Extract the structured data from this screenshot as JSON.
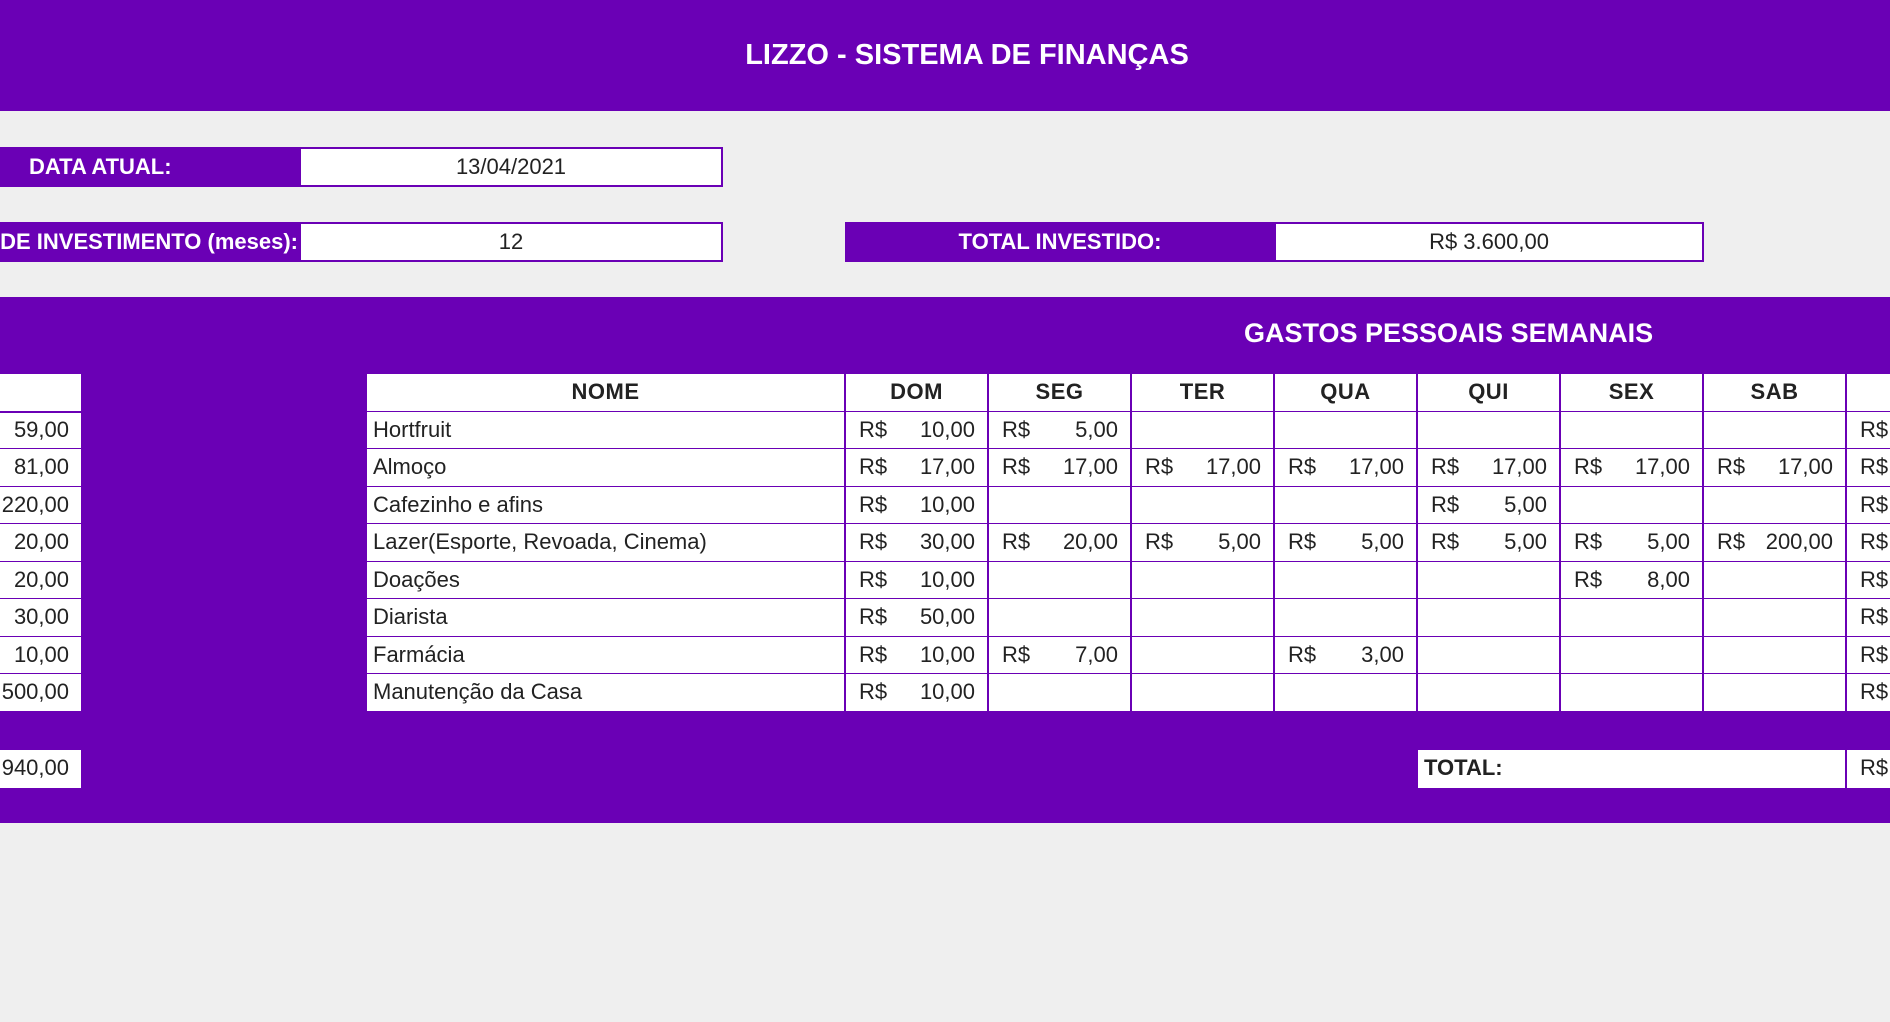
{
  "app": {
    "title": "LIZZO - SISTEMA DE FINANÇAS"
  },
  "info": {
    "date_label": "DATA ATUAL:",
    "date_value": "13/04/2021",
    "period_label": "DE INVESTIMENTO (meses):",
    "period_value": "12",
    "total_invested_label": "TOTAL INVESTIDO:",
    "total_invested_value": "R$ 3.600,00"
  },
  "section": {
    "title": "GASTOS PESSOAIS SEMANAIS"
  },
  "left_column": {
    "values": [
      "59,00",
      "81,00",
      "220,00",
      "20,00",
      "20,00",
      "30,00",
      "10,00",
      "500,00"
    ],
    "total": "940,00"
  },
  "table": {
    "currency": "R$",
    "headers": [
      "NOME",
      "DOM",
      "SEG",
      "TER",
      "QUA",
      "QUI",
      "SEX",
      "SAB"
    ],
    "rows": [
      {
        "name": "Hortfruit",
        "days": [
          "10,00",
          "5,00",
          "",
          "",
          "",
          "",
          ""
        ],
        "partial": "R$"
      },
      {
        "name": "Almoço",
        "days": [
          "17,00",
          "17,00",
          "17,00",
          "17,00",
          "17,00",
          "17,00",
          "17,00"
        ],
        "partial": "R$"
      },
      {
        "name": "Cafezinho e afins",
        "days": [
          "10,00",
          "",
          "",
          "",
          "5,00",
          "",
          ""
        ],
        "partial": "R$"
      },
      {
        "name": "Lazer(Esporte, Revoada, Cinema)",
        "days": [
          "30,00",
          "20,00",
          "5,00",
          "5,00",
          "5,00",
          "5,00",
          "200,00"
        ],
        "partial": "R$"
      },
      {
        "name": "Doações",
        "days": [
          "10,00",
          "",
          "",
          "",
          "",
          "8,00",
          ""
        ],
        "partial": "R$"
      },
      {
        "name": "Diarista",
        "days": [
          "50,00",
          "",
          "",
          "",
          "",
          "",
          ""
        ],
        "partial": "R$"
      },
      {
        "name": "Farmácia",
        "days": [
          "10,00",
          "7,00",
          "",
          "3,00",
          "",
          "",
          ""
        ],
        "partial": "R$"
      },
      {
        "name": "Manutenção da Casa",
        "days": [
          "10,00",
          "",
          "",
          "",
          "",
          "",
          ""
        ],
        "partial": "R$"
      }
    ],
    "total_label": "TOTAL:",
    "total_partial": "R$"
  },
  "colors": {
    "brand": "#6a00b5",
    "background": "#efefef",
    "cell": "#ffffff"
  }
}
